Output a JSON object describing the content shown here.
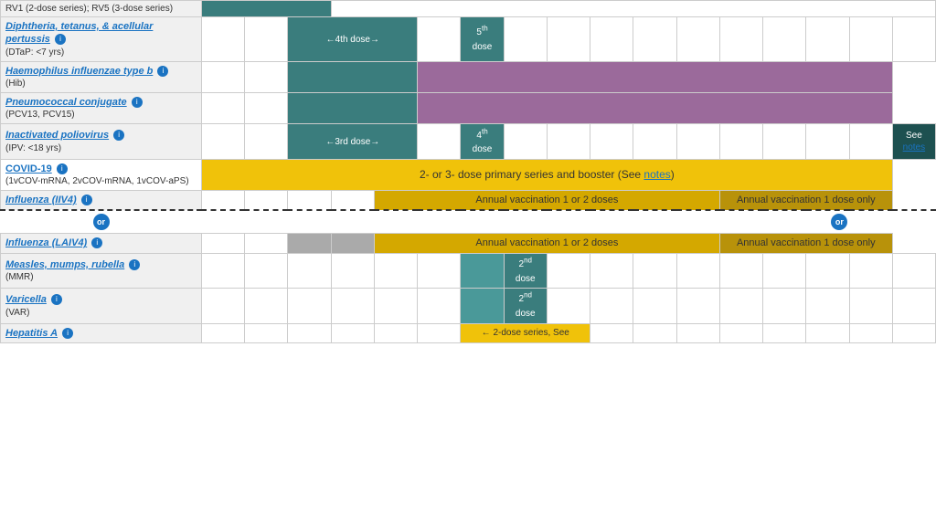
{
  "vaccines": [
    {
      "name": "RV1 (2-dose series); RV5 (3-dose series)",
      "link": false,
      "sub": "",
      "info": false,
      "row_type": "rv_top"
    },
    {
      "id": "dtap",
      "name": "Diphtheria, tetanus, & acellular pertussis",
      "link": true,
      "sub": "(DTaP: <7 yrs)",
      "info": true,
      "row_type": "normal"
    },
    {
      "id": "hib",
      "name": "Haemophilus influenzae type b",
      "link": true,
      "sub": "(Hib)",
      "info": true,
      "row_type": "normal",
      "italic": true
    },
    {
      "id": "pcv",
      "name": "Pneumococcal conjugate",
      "link": true,
      "sub": "(PCV13, PCV15)",
      "info": true,
      "row_type": "normal"
    },
    {
      "id": "ipv",
      "name": "Inactivated poliovirus",
      "link": true,
      "sub": "(IPV: <18 yrs)",
      "info": true,
      "row_type": "normal"
    },
    {
      "id": "covid",
      "name": "COVID-19",
      "link": true,
      "sub": "(1vCOV-mRNA, 2vCOV-mRNA, 1vCOV-aPS)",
      "info": true,
      "row_type": "covid"
    },
    {
      "id": "iiv4",
      "name": "Influenza (IIV4)",
      "link": true,
      "sub": "",
      "info": true,
      "row_type": "influenza_iiv4"
    },
    {
      "id": "laiv4",
      "name": "Influenza (LAIV4)",
      "link": true,
      "sub": "",
      "info": true,
      "row_type": "influenza_laiv4"
    },
    {
      "id": "mmr",
      "name": "Measles, mumps, rubella",
      "link": true,
      "sub": "(MMR)",
      "info": true,
      "row_type": "normal"
    },
    {
      "id": "var",
      "name": "Varicella",
      "link": true,
      "sub": "(VAR)",
      "info": true,
      "row_type": "normal"
    },
    {
      "id": "hepa",
      "name": "Hepatitis A",
      "link": true,
      "sub": "",
      "info": true,
      "row_type": "hepa"
    }
  ],
  "labels": {
    "rv_text": "RV1 (2-dose series); RV5 (3-dose series)",
    "dtap_dose4": "←4th dose→",
    "dtap_dose5": "5th dose",
    "ipv_dose3": "←3rd dose→",
    "ipv_dose4": "4th dose",
    "ipv_see": "See",
    "ipv_notes": "notes",
    "covid_text": "2- or 3- dose primary series and booster (See notes)",
    "covid_notes": "notes",
    "iiv4_annual1": "Annual vaccination 1 or 2 doses",
    "iiv4_annual2": "Annual vaccination 1 dose only",
    "laiv4_annual1": "Annual vaccination 1 or 2 doses",
    "laiv4_annual2": "Annual vaccination 1 dose only",
    "mmr_dose2": "2nd dose",
    "var_dose2": "2nd dose",
    "hepa_text": "← 2-dose series, See",
    "or_label": "or"
  }
}
